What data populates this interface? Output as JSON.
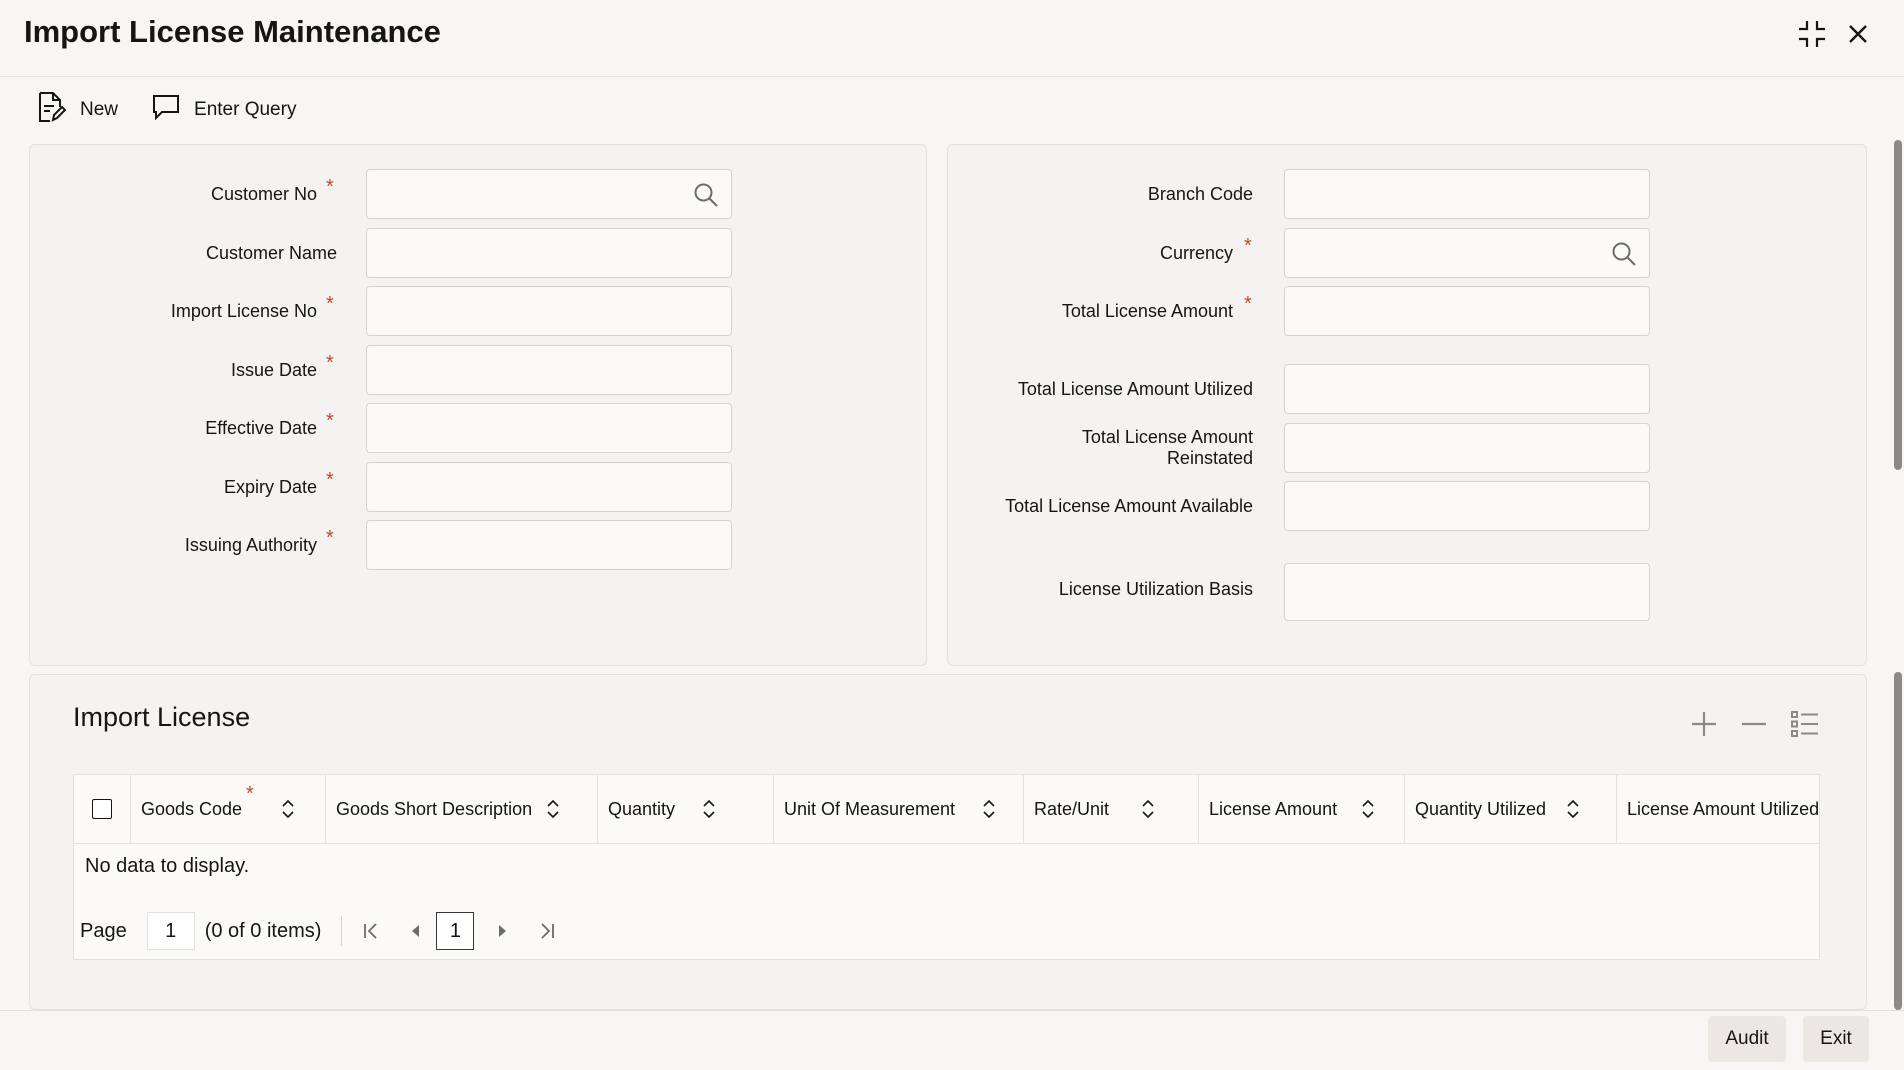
{
  "window": {
    "title": "Import License Maintenance",
    "minimize_icon": "collapse-icon",
    "close_icon": "close-icon"
  },
  "toolbar": {
    "new_label": "New",
    "enter_query_label": "Enter Query"
  },
  "left_form": {
    "customer_no_label": "Customer No",
    "customer_name_label": "Customer Name",
    "import_license_no_label": "Import License No",
    "issue_date_label": "Issue Date",
    "effective_date_label": "Effective Date",
    "expiry_date_label": "Expiry Date",
    "issuing_authority_label": "Issuing Authority",
    "required_mark": "*"
  },
  "right_form": {
    "branch_code_label": "Branch Code",
    "currency_label": "Currency",
    "total_license_amount_label": "Total License Amount",
    "total_license_amount_utilized_label": "Total License Amount Utilized",
    "total_license_amount_reinstated_label": "Total License Amount Reinstated",
    "total_license_amount_available_label": "Total License Amount Available",
    "license_utilization_basis_label": "License Utilization Basis"
  },
  "import_license": {
    "title": "Import License",
    "columns": [
      "Goods Code",
      "Goods Short Description",
      "Quantity",
      "Unit Of Measurement",
      "Rate/Unit",
      "License Amount",
      "Quantity Utilized",
      "License Amount Utilized"
    ],
    "no_data": "No data to display.",
    "page_label": "Page",
    "page_value": "1",
    "items_text": "(0 of 0 items)",
    "current_page": "1"
  },
  "footer": {
    "audit_label": "Audit",
    "exit_label": "Exit"
  }
}
